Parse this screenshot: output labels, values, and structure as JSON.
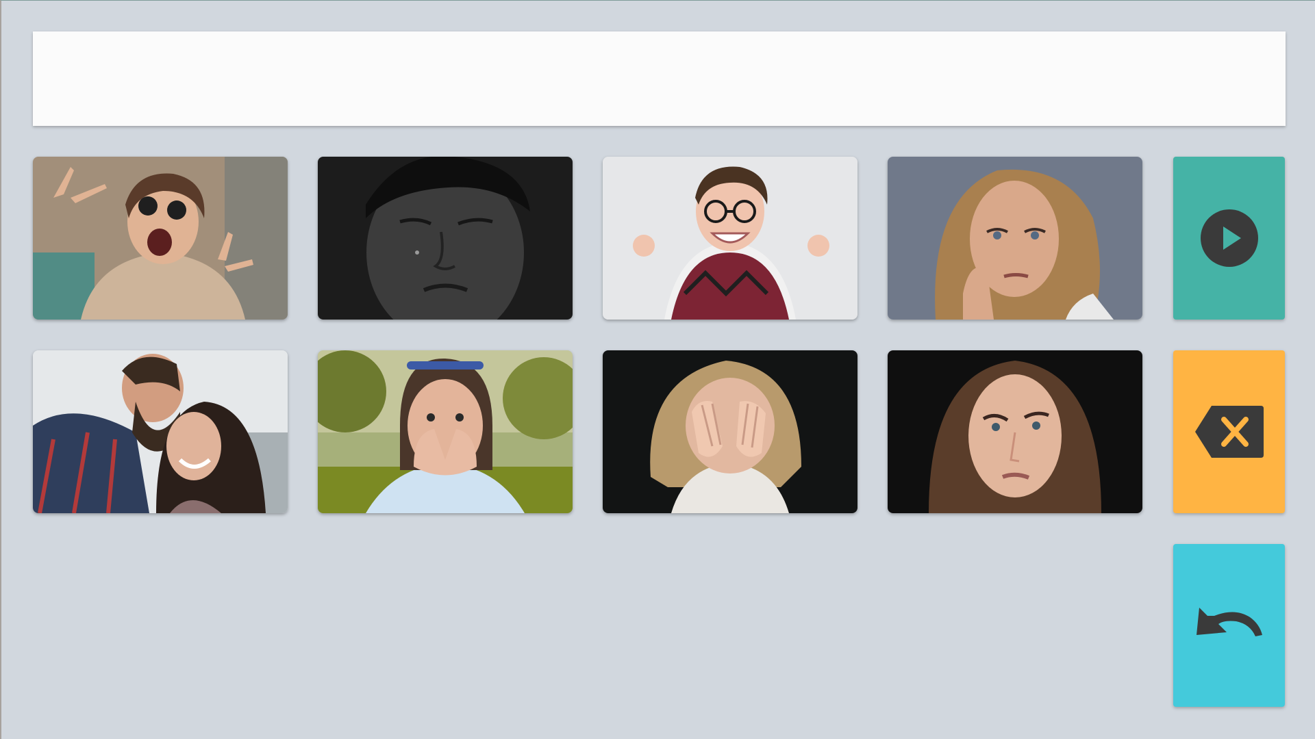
{
  "theme": {
    "background": "#d1d7de",
    "output_bg": "#fbfbfb",
    "play_color": "#45b3a6",
    "backspace_color": "#ffb443",
    "undo_color": "#44cadb",
    "icon_color": "#3a3a3a"
  },
  "output": {
    "text": ""
  },
  "tiles": [
    {
      "name": "excited",
      "label": "",
      "icon": "excited-face-photo"
    },
    {
      "name": "sad",
      "label": "",
      "icon": "sad-face-photo"
    },
    {
      "name": "happy",
      "label": "",
      "icon": "happy-face-photo"
    },
    {
      "name": "bored",
      "label": "",
      "icon": "bored-face-photo"
    },
    {
      "name": "love",
      "label": "",
      "icon": "love-couple-photo"
    },
    {
      "name": "surprised",
      "label": "",
      "icon": "surprised-face-photo"
    },
    {
      "name": "shy",
      "label": "",
      "icon": "shy-child-photo"
    },
    {
      "name": "confused",
      "label": "",
      "icon": "confused-face-photo"
    }
  ],
  "controls": {
    "play": {
      "icon": "play-icon"
    },
    "backspace": {
      "icon": "backspace-icon"
    },
    "undo": {
      "icon": "undo-icon"
    }
  }
}
